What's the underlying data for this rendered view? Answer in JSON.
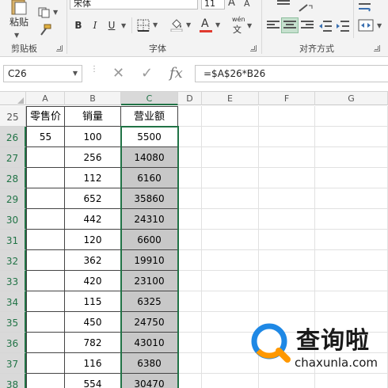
{
  "ribbon": {
    "clipboard": {
      "paste_label": "粘贴",
      "group_label": "剪贴板"
    },
    "font": {
      "name": "宋体",
      "size": "11",
      "bold": "B",
      "italic": "I",
      "underline": "U",
      "font_color_glyph": "A",
      "phonetic_top": "wén",
      "phonetic_bottom": "文",
      "grow_font": "A",
      "shrink_font": "A",
      "group_label": "字体",
      "font_color": "#e03a2f"
    },
    "alignment": {
      "group_label": "对齐方式"
    }
  },
  "formula_bar": {
    "name_box": "C26",
    "fx_label": "fx",
    "formula": "=$A$26*B26"
  },
  "grid": {
    "columns": [
      "A",
      "B",
      "C",
      "D",
      "E",
      "F",
      "G"
    ],
    "selected_column": "C",
    "header_row": {
      "row": "25",
      "a": "零售价",
      "b": "销量",
      "c": "营业额"
    },
    "rows": [
      {
        "row": "26",
        "a": "55",
        "b": "100",
        "c": "5500"
      },
      {
        "row": "27",
        "a": "",
        "b": "256",
        "c": "14080"
      },
      {
        "row": "28",
        "a": "",
        "b": "112",
        "c": "6160"
      },
      {
        "row": "29",
        "a": "",
        "b": "652",
        "c": "35860"
      },
      {
        "row": "30",
        "a": "",
        "b": "442",
        "c": "24310"
      },
      {
        "row": "31",
        "a": "",
        "b": "120",
        "c": "6600"
      },
      {
        "row": "32",
        "a": "",
        "b": "362",
        "c": "19910"
      },
      {
        "row": "33",
        "a": "",
        "b": "420",
        "c": "23100"
      },
      {
        "row": "34",
        "a": "",
        "b": "115",
        "c": "6325"
      },
      {
        "row": "35",
        "a": "",
        "b": "450",
        "c": "24750"
      },
      {
        "row": "36",
        "a": "",
        "b": "782",
        "c": "43010"
      },
      {
        "row": "37",
        "a": "",
        "b": "116",
        "c": "6380"
      },
      {
        "row": "38",
        "a": "",
        "b": "554",
        "c": "30470"
      }
    ],
    "selection_color": "#217346"
  },
  "watermark": {
    "title": "查询啦",
    "url": "chaxunla.com",
    "brand_blue": "#1e88e5",
    "brand_orange": "#ff9800"
  }
}
